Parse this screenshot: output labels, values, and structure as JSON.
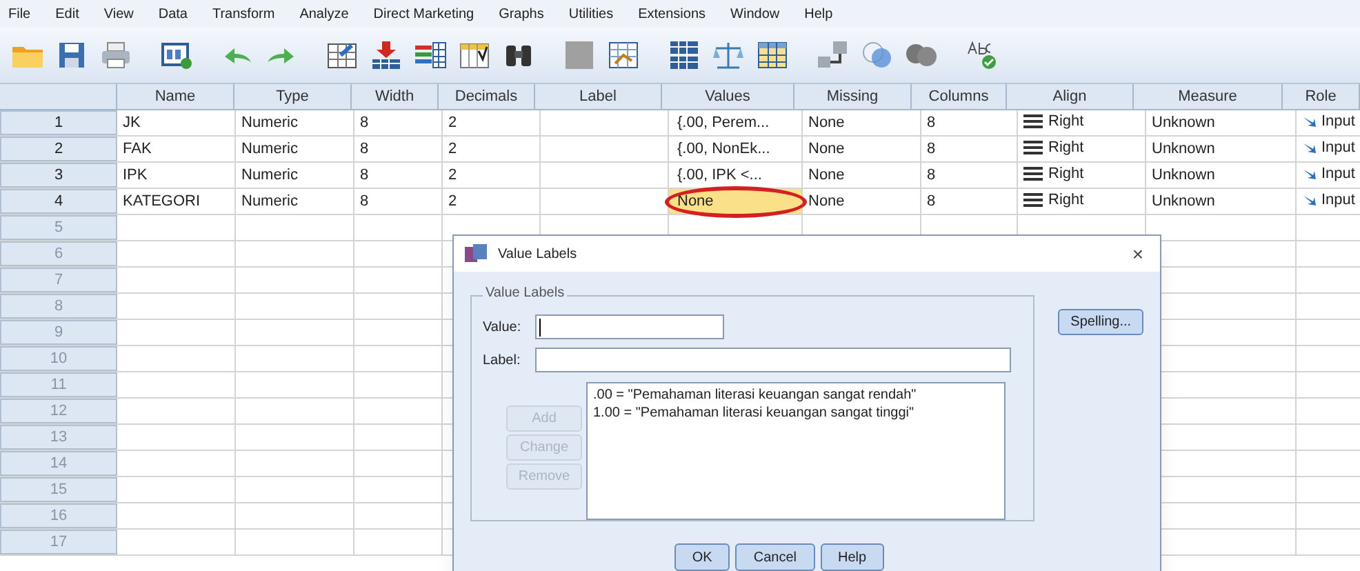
{
  "menu": [
    "File",
    "Edit",
    "View",
    "Data",
    "Transform",
    "Analyze",
    "Direct Marketing",
    "Graphs",
    "Utilities",
    "Extensions",
    "Window",
    "Help"
  ],
  "table": {
    "columns": [
      "Name",
      "Type",
      "Width",
      "Decimals",
      "Label",
      "Values",
      "Missing",
      "Columns",
      "Align",
      "Measure",
      "Role"
    ],
    "rows": [
      {
        "number": "1",
        "values_highlighted": false,
        "cells": [
          "JK",
          "Numeric",
          "8",
          "2",
          "",
          "{.00, Perem...",
          "None",
          "8",
          "Right",
          "Unknown",
          "Input"
        ]
      },
      {
        "number": "2",
        "values_highlighted": false,
        "cells": [
          "FAK",
          "Numeric",
          "8",
          "2",
          "",
          "{.00, NonEk...",
          "None",
          "8",
          "Right",
          "Unknown",
          "Input"
        ]
      },
      {
        "number": "3",
        "values_highlighted": false,
        "cells": [
          "IPK",
          "Numeric",
          "8",
          "2",
          "",
          "{.00, IPK <...",
          "None",
          "8",
          "Right",
          "Unknown",
          "Input"
        ]
      },
      {
        "number": "4",
        "values_highlighted": true,
        "cells": [
          "KATEGORI",
          "Numeric",
          "8",
          "2",
          "",
          "None",
          "None",
          "8",
          "Right",
          "Unknown",
          "Input"
        ]
      },
      {
        "number": "5"
      },
      {
        "number": "6"
      },
      {
        "number": "7"
      },
      {
        "number": "8"
      },
      {
        "number": "9"
      },
      {
        "number": "10"
      },
      {
        "number": "11"
      },
      {
        "number": "12"
      },
      {
        "number": "13"
      },
      {
        "number": "14"
      },
      {
        "number": "15"
      },
      {
        "number": "16"
      },
      {
        "number": "17"
      }
    ]
  },
  "dialog": {
    "title": "Value Labels",
    "close": "×",
    "group_label": "Value Labels",
    "value_field": {
      "label": "Value:"
    },
    "label_field": {
      "label": "Label:"
    },
    "spelling_button": {
      "label": "Spelling...",
      "disabled": false
    },
    "side_buttons": [
      {
        "label": "Add",
        "disabled": true
      },
      {
        "label": "Change",
        "disabled": true
      },
      {
        "label": "Remove",
        "disabled": true
      }
    ],
    "list": [
      ".00 = \"Pemahaman literasi keuangan sangat rendah\"",
      "1.00 = \"Pemahaman literasi keuangan sangat tinggi\""
    ],
    "buttons": [
      {
        "label": "OK"
      },
      {
        "label": "Cancel"
      },
      {
        "label": "Help"
      }
    ]
  }
}
